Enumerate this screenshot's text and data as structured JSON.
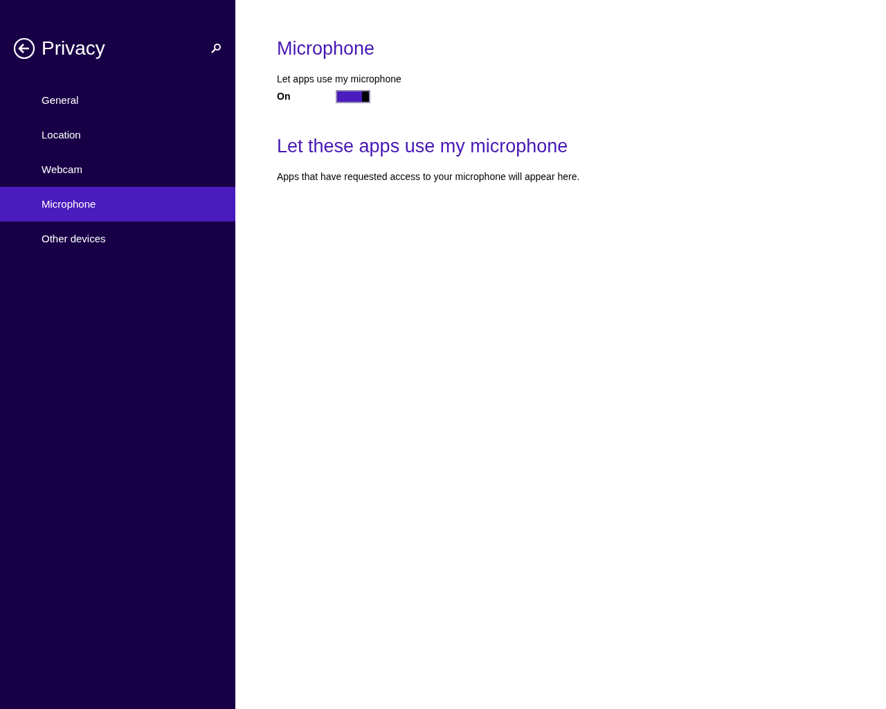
{
  "sidebar": {
    "title": "Privacy",
    "items": [
      {
        "label": "General",
        "selected": false
      },
      {
        "label": "Location",
        "selected": false
      },
      {
        "label": "Webcam",
        "selected": false
      },
      {
        "label": "Microphone",
        "selected": true
      },
      {
        "label": "Other devices",
        "selected": false
      }
    ]
  },
  "content": {
    "heading": "Microphone",
    "toggle": {
      "label": "Let apps use my microphone",
      "state_text": "On",
      "on": true
    },
    "apps_heading": "Let these apps use my microphone",
    "apps_note": "Apps that have requested access to your microphone will appear here."
  }
}
